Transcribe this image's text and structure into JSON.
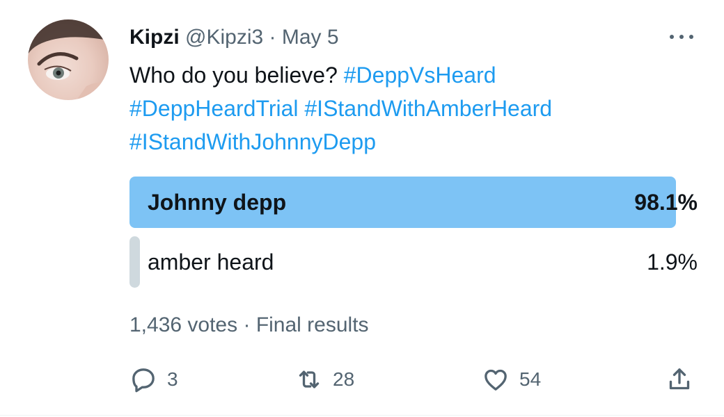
{
  "author": {
    "name": "Kipzi",
    "handle": "@Kipzi3",
    "separator": "·",
    "date": "May 5"
  },
  "tweet": {
    "text": "Who do you believe?",
    "hashtags": [
      "#DeppVsHeard",
      "#DeppHeardTrial",
      "#IStandWithAmberHeard",
      "#IStandWithJohnnyDepp"
    ]
  },
  "poll": {
    "options": [
      {
        "label": "Johnny depp",
        "percent_text": "98.1%",
        "percent": 98.1,
        "winner": true
      },
      {
        "label": "amber heard",
        "percent_text": "1.9%",
        "percent": 1.9,
        "winner": false
      }
    ],
    "votes": "1,436 votes",
    "separator": "·",
    "status": "Final results"
  },
  "actions": {
    "replies": "3",
    "retweets": "28",
    "likes": "54"
  },
  "colors": {
    "accent": "#1d9bf0",
    "winner_bar": "#7dc3f5",
    "loser_bar": "#cfd9de",
    "muted": "#536471"
  },
  "icons": [
    "more-icon",
    "reply-icon",
    "retweet-icon",
    "like-icon",
    "share-icon"
  ]
}
